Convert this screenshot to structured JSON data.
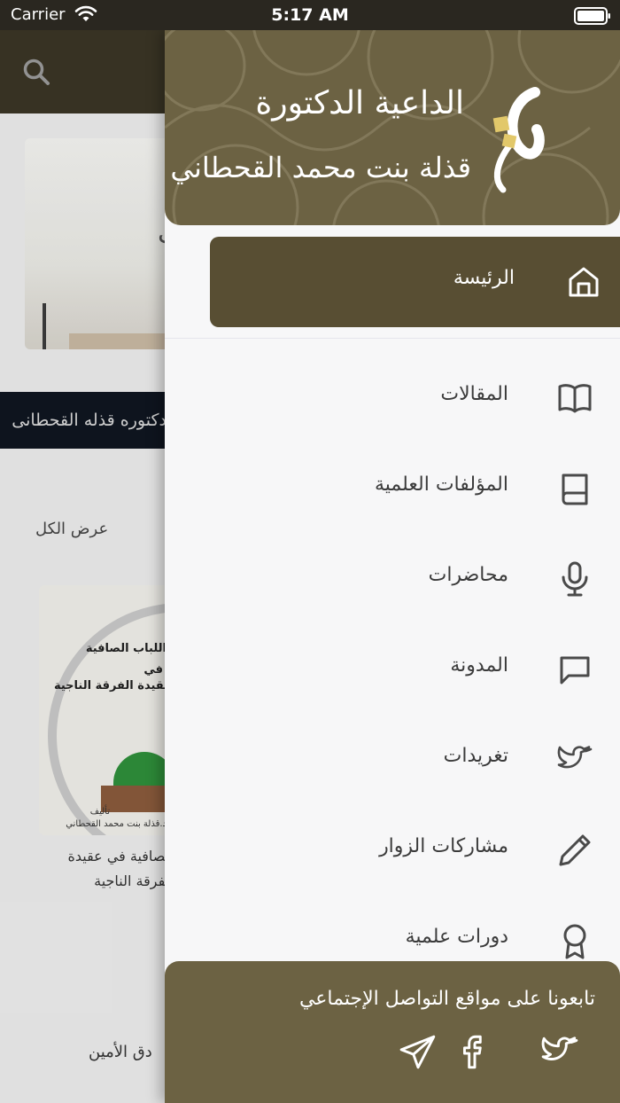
{
  "status_bar": {
    "carrier": "Carrier",
    "time": "5:17 AM"
  },
  "background": {
    "banner_text": "دكتوره قذله القحطانى",
    "view_all": "عرض الكل",
    "book_cover": {
      "title_line1": "اللباب الصافية",
      "title_line2": "في",
      "title_line3": "عقيدة الفرقة الناجية",
      "author_label": "تأليف",
      "author_name": "د.قذلة بنت محمد القحطاني"
    },
    "book_title_line1": "الصافية في عقيدة",
    "book_title_line2": "الفرقة الناجية",
    "bottom_text": "دق الأمين"
  },
  "drawer": {
    "brand_line1": "الداعية الدكتورة",
    "brand_line2": "قذلة بنت محمد القحطاني",
    "active_item": {
      "label": "الرئيسة",
      "icon": "home-icon"
    },
    "items": [
      {
        "label": "المقالات",
        "icon": "open-book-icon"
      },
      {
        "label": "المؤلفات العلمية",
        "icon": "book-icon"
      },
      {
        "label": "محاضرات",
        "icon": "microphone-icon"
      },
      {
        "label": "المدونة",
        "icon": "chat-bubble-icon"
      },
      {
        "label": "تغريدات",
        "icon": "twitter-icon"
      },
      {
        "label": "مشاركات الزوار",
        "icon": "pencil-icon"
      },
      {
        "label": "دورات علمية",
        "icon": "award-icon"
      }
    ],
    "social": {
      "title": "تابعونا على مواقع التواصل الإجتماعي",
      "icons": [
        "twitter-icon",
        "facebook-icon",
        "telegram-icon"
      ]
    }
  },
  "colors": {
    "header_bg": "#3a3525",
    "drawer_header": "#6c6243",
    "active_item": "#584e33",
    "menu_text": "#3b3b3b",
    "icon_stroke": "#4a4a4a"
  }
}
